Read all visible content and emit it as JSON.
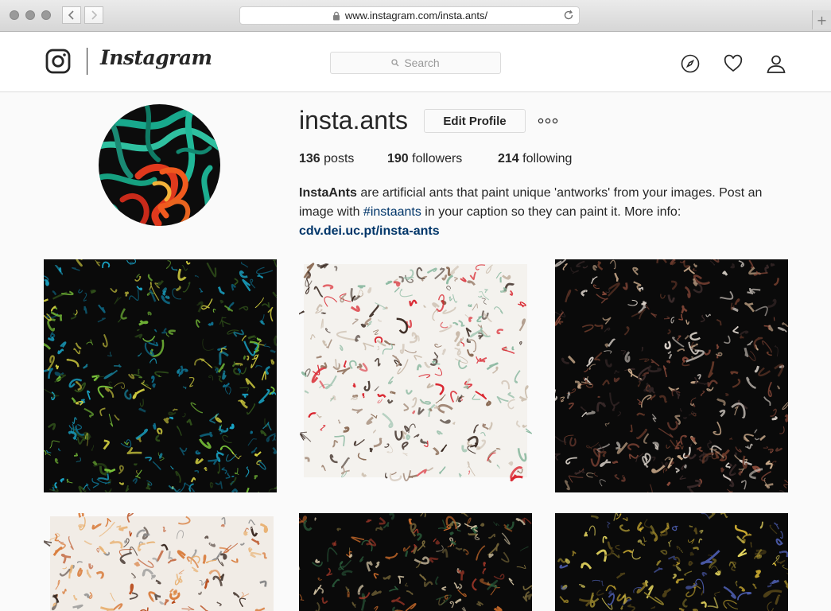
{
  "browser": {
    "url": "www.instagram.com/insta.ants/",
    "new_tab": "+"
  },
  "header": {
    "wordmark": "Instagram",
    "search_placeholder": "Search",
    "icons": [
      "explore-icon",
      "activity-heart-icon",
      "profile-icon"
    ]
  },
  "profile": {
    "username": "insta.ants",
    "edit_button": "Edit Profile",
    "more_icon": "more-options-icon",
    "stats": {
      "posts_count": "136",
      "posts_label": "posts",
      "followers_count": "190",
      "followers_label": "followers",
      "following_count": "214",
      "following_label": "following"
    },
    "bio": {
      "name": "InstaAnts",
      "text1": " are artificial ants that paint unique 'antworks' from your images. Post an image with ",
      "hashtag": "#instaants",
      "text2": " in your caption so they can paint it. More info:",
      "link": "cdv.dei.uc.pt/insta-ants"
    }
  },
  "posts": [
    {
      "name": "post-1",
      "palette": [
        "#0a0a0a",
        "#1aa6c8",
        "#0e6e8c",
        "#7ac43a",
        "#d4d040",
        "#2f4f1a"
      ]
    },
    {
      "name": "post-2",
      "palette": [
        "#f4f2ee",
        "#3a2a22",
        "#8a6a54",
        "#c8b9a8",
        "#d8202a",
        "#8ab8a0"
      ]
    },
    {
      "name": "post-3",
      "palette": [
        "#0a0a0a",
        "#c9a98a",
        "#8a4a3a",
        "#d8d0c8",
        "#3a2a2a",
        "#6a3a2a"
      ]
    },
    {
      "name": "post-4",
      "palette": [
        "#f1ece6",
        "#d87a38",
        "#b84a1a",
        "#8a8a8a",
        "#e8b070",
        "#3a2a22"
      ]
    },
    {
      "name": "post-5",
      "palette": [
        "#0a0a0a",
        "#c86a2a",
        "#7a6a3a",
        "#d8c8a8",
        "#2a5a3a",
        "#a83a2a"
      ]
    },
    {
      "name": "post-6",
      "palette": [
        "#0a0a0a",
        "#c8a830",
        "#8a7a2a",
        "#e8d860",
        "#4a5aa8",
        "#5a4a1a"
      ]
    }
  ]
}
